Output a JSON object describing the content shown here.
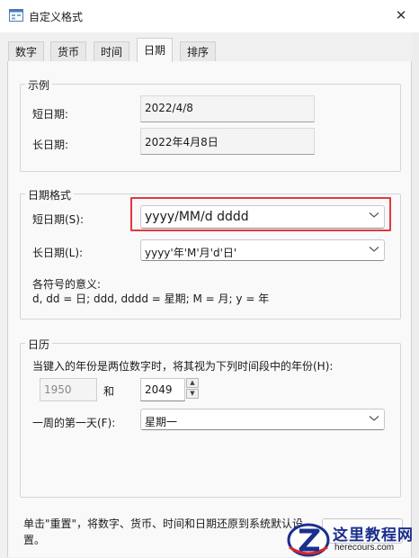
{
  "window": {
    "title": "自定义格式",
    "close_glyph": "✕"
  },
  "tabs": [
    {
      "label": "数字"
    },
    {
      "label": "货币"
    },
    {
      "label": "时间"
    },
    {
      "label": "日期"
    },
    {
      "label": "排序"
    }
  ],
  "active_tab": "日期",
  "example": {
    "title": "示例",
    "short_label": "短日期:",
    "short_value": "2022/4/8",
    "long_label": "长日期:",
    "long_value": "2022年4月8日"
  },
  "date_format": {
    "title": "日期格式",
    "short_label": "短日期(S):",
    "short_value": "yyyy/MM/d dddd",
    "long_label": "长日期(L):",
    "long_value": "yyyy'年'M'月'd'日'",
    "legend_title": "各符号的意义:",
    "legend_text": "d, dd = 日;  ddd, dddd = 星期;  M = 月;  y = 年"
  },
  "calendar": {
    "title": "日历",
    "two_digit_text": "当键入的年份是两位数字时，将其视为下列时间段中的年份(H):",
    "start_year": "1950",
    "and_label": "和",
    "end_year": "2049",
    "first_day_label": "一周的第一天(F):",
    "first_day_value": "星期一"
  },
  "footer": {
    "reset_text_line1": "单击\"重置\"，将数字、货币、时间和日期还原到系统默认设",
    "reset_text_line2": "置。"
  },
  "watermark": {
    "title": "这里教程网",
    "url": "herecours.com"
  },
  "colors": {
    "highlight": "#e0393e",
    "watermark_blue": "#1b2f8f"
  }
}
